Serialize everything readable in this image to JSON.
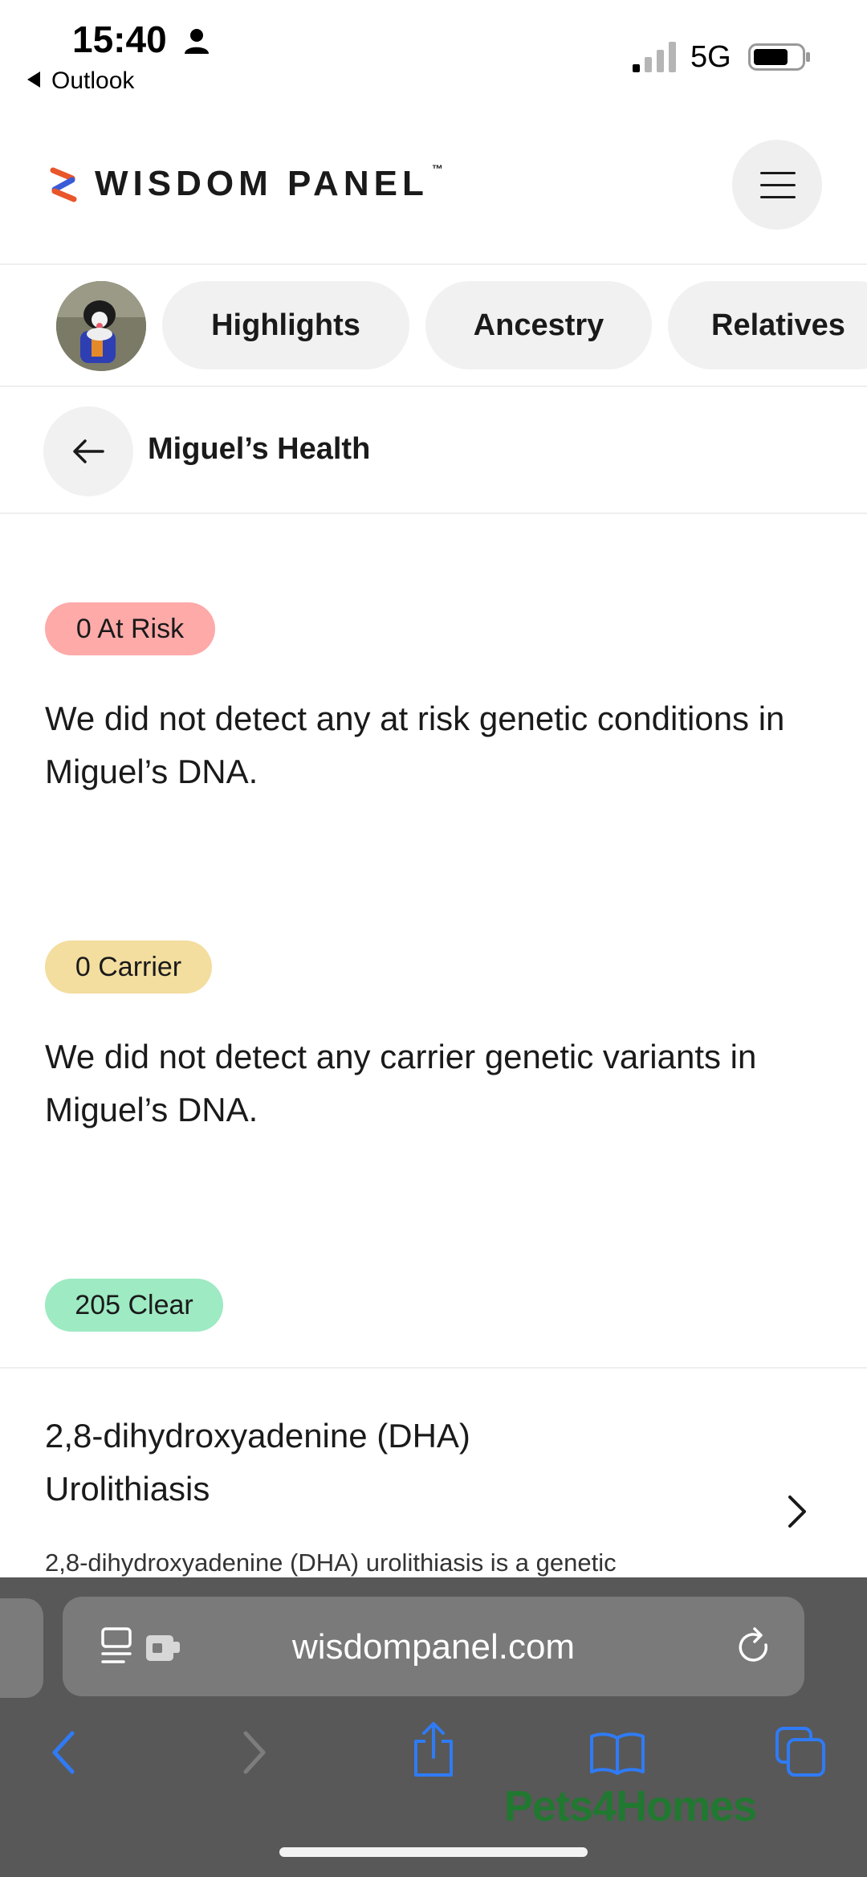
{
  "status": {
    "time": "15:40",
    "back_app": "Outlook",
    "network": "5G"
  },
  "header": {
    "logo_text": "WISDOM PANEL",
    "trademark": "™",
    "menu_icon": "hamburger-menu-icon"
  },
  "tabs": {
    "items": [
      "Highlights",
      "Ancestry",
      "Relatives"
    ]
  },
  "subheader": {
    "title": "Miguel’s Health"
  },
  "results": {
    "at_risk": {
      "badge": "0 At Risk",
      "color": "#fdaaa9",
      "message": "We did not detect any at risk genetic conditions in Miguel’s DNA."
    },
    "carrier": {
      "badge": "0 Carrier",
      "color": "#f3dd9f",
      "message": "We did not detect any carrier genetic variants in Miguel’s DNA."
    },
    "clear": {
      "badge": "205 Clear",
      "color": "#9eeac3"
    }
  },
  "condition": {
    "title": "2,8-dihydroxyadenine (DHA) Urolithiasis",
    "description": "2,8-dihydroxyadenine (DHA) urolithiasis is a genetic"
  },
  "browser": {
    "url": "wisdompanel.com",
    "accent": "#2f7bf6"
  },
  "watermark": "Pets4Homes"
}
